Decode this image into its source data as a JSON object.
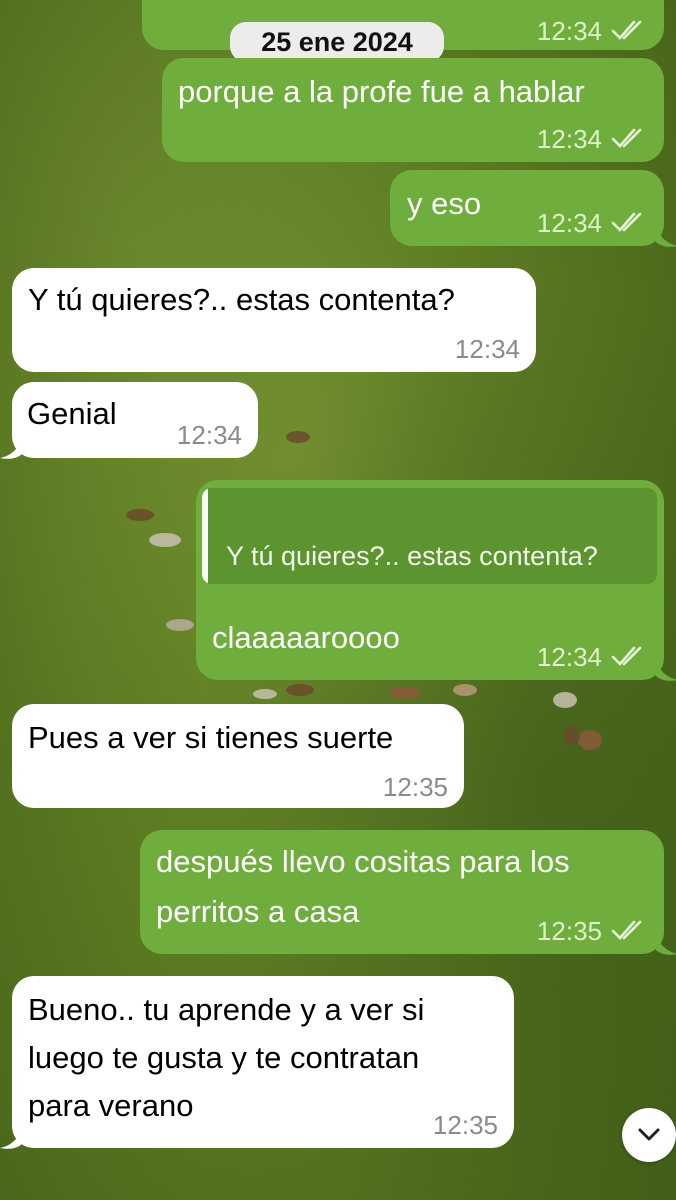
{
  "chat": {
    "date_label": "25 ene 2024",
    "messages": [
      {
        "direction": "out",
        "text": "",
        "time": "12:34",
        "status": "read"
      },
      {
        "direction": "out",
        "text": "porque a la profe fue a hablar",
        "time": "12:34",
        "status": "read"
      },
      {
        "direction": "out",
        "text": "y eso",
        "time": "12:34",
        "status": "read"
      },
      {
        "direction": "in",
        "text": "Y tú quieres?.. estas contenta?",
        "time": "12:34"
      },
      {
        "direction": "in",
        "text": "Genial",
        "time": "12:34"
      },
      {
        "direction": "out",
        "quote": "Y tú quieres?.. estas contenta?",
        "text": "claaaaaroooo",
        "time": "12:34",
        "status": "read"
      },
      {
        "direction": "in",
        "text": "Pues a ver si tienes suerte",
        "time": "12:35"
      },
      {
        "direction": "out",
        "lines": [
          "después llevo cositas para los",
          "perritos a casa"
        ],
        "time": "12:35",
        "status": "read"
      },
      {
        "direction": "in",
        "lines": [
          "Bueno.. tu aprende y a ver si",
          "luego te gusta y te contratan",
          "para verano"
        ],
        "time": "12:35"
      }
    ]
  },
  "icons": {
    "read_receipt": "double-check-icon",
    "scroll_down": "chevron-down-icon"
  },
  "colors": {
    "outgoing_bubble": "#6fae3c",
    "incoming_bubble": "#ffffff",
    "date_pill": "#ececea"
  }
}
